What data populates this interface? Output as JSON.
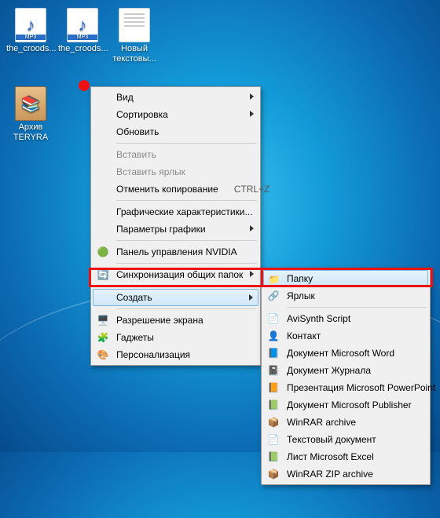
{
  "desktop_icons": [
    {
      "name": "file-the-croods-1",
      "type": "mp3",
      "label": "the_croods..."
    },
    {
      "name": "file-the-croods-2",
      "type": "mp3",
      "label": "the_croods..."
    },
    {
      "name": "file-new-text",
      "type": "txt",
      "label": "Новый текстовы..."
    },
    {
      "name": "file-archive-teryra",
      "type": "rar",
      "label": "Архив TERYRA"
    }
  ],
  "main_menu": {
    "items": [
      {
        "label": "Вид",
        "submenu": true
      },
      {
        "label": "Сортировка",
        "submenu": true
      },
      {
        "label": "Обновить"
      },
      {
        "sep": true
      },
      {
        "label": "Вставить",
        "disabled": true
      },
      {
        "label": "Вставить ярлык",
        "disabled": true
      },
      {
        "label": "Отменить копирование",
        "shortcut": "CTRL+Z"
      },
      {
        "sep": true
      },
      {
        "label": "Графические характеристики..."
      },
      {
        "label": "Параметры графики",
        "submenu": true
      },
      {
        "sep": true
      },
      {
        "label": "Панель управления NVIDIA",
        "icon": "🟢"
      },
      {
        "sep": true
      },
      {
        "label": "Синхронизация общих папок",
        "icon": "🔄",
        "submenu": true
      },
      {
        "sep": true
      },
      {
        "label": "Создать",
        "submenu": true,
        "hover": true
      },
      {
        "sep": true
      },
      {
        "label": "Разрешение экрана",
        "icon": "🖥️"
      },
      {
        "label": "Гаджеты",
        "icon": "🧩"
      },
      {
        "label": "Персонализация",
        "icon": "🎨"
      }
    ]
  },
  "sub_menu": {
    "items": [
      {
        "label": "Папку",
        "icon": "📁",
        "hover": true
      },
      {
        "label": "Ярлык",
        "icon": "🔗"
      },
      {
        "sep": true
      },
      {
        "label": "AviSynth Script",
        "icon": "📄"
      },
      {
        "label": "Контакт",
        "icon": "👤"
      },
      {
        "label": "Документ Microsoft Word",
        "icon": "📘"
      },
      {
        "label": "Документ Журнала",
        "icon": "📓"
      },
      {
        "label": "Презентация Microsoft PowerPoint",
        "icon": "📙"
      },
      {
        "label": "Документ Microsoft Publisher",
        "icon": "📗"
      },
      {
        "label": "WinRAR archive",
        "icon": "📦"
      },
      {
        "label": "Текстовый документ",
        "icon": "📄"
      },
      {
        "label": "Лист Microsoft Excel",
        "icon": "📗"
      },
      {
        "label": "WinRAR ZIP archive",
        "icon": "📦"
      }
    ]
  },
  "mp3_badge": "MP3"
}
